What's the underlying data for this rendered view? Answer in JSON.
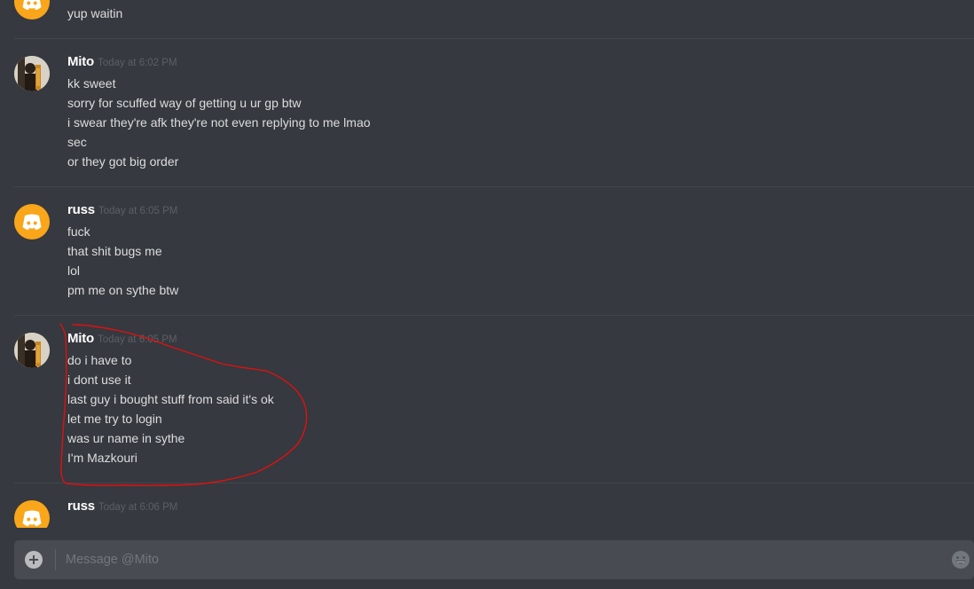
{
  "messages": [
    {
      "author": "",
      "timestamp": "",
      "avatar": "discord-logo-icon",
      "lines": [
        "yup waitin"
      ]
    },
    {
      "author": "Mito",
      "timestamp": "Today at 6:02 PM",
      "avatar": "user-photo-avatar",
      "lines": [
        "kk sweet",
        "sorry for scuffed way of getting u ur gp btw",
        "i swear they're afk they're not even replying to me lmao",
        "sec",
        "or they got big order"
      ]
    },
    {
      "author": "russ",
      "timestamp": "Today at 6:05 PM",
      "avatar": "discord-logo-icon",
      "lines": [
        "fuck",
        "that shit bugs me",
        "lol",
        "pm me on sythe btw"
      ]
    },
    {
      "author": "Mito",
      "timestamp": "Today at 6:05 PM",
      "avatar": "user-photo-avatar",
      "lines": [
        "do i have to",
        "i dont use it",
        "last guy i bought stuff from said it's ok",
        "let me try to login",
        "was ur name in sythe",
        "I'm Mazkouri"
      ]
    },
    {
      "author": "russ",
      "timestamp": "Today at 6:06 PM",
      "avatar": "discord-logo-icon",
      "lines": []
    }
  ],
  "composer": {
    "placeholder": "Message @Mito",
    "attach_icon": "plus-circle-icon",
    "emoji_icon": "emoji-grin-icon"
  },
  "colors": {
    "background": "#36393f",
    "discord_avatar": "#faa61a",
    "annotation": "#e01010"
  }
}
